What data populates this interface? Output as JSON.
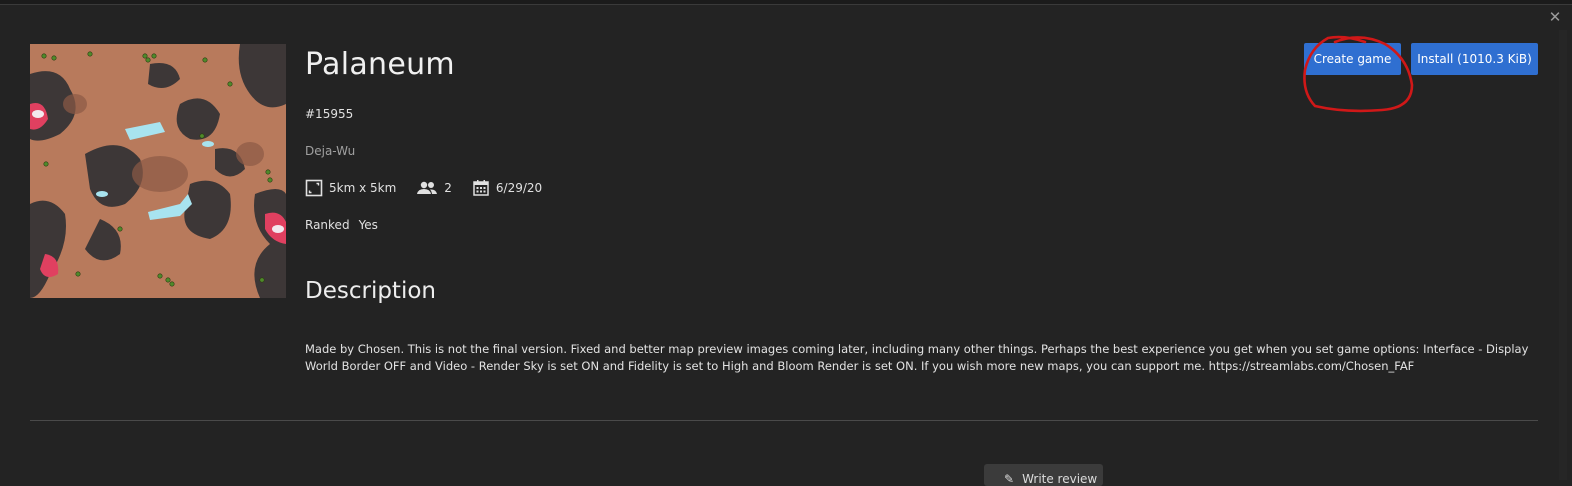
{
  "window": {
    "close_icon": "close-icon"
  },
  "map": {
    "title": "Palaneum",
    "id": "#15955",
    "author": "Deja-Wu",
    "size": "5km x 5km",
    "players": "2",
    "date": "6/29/20",
    "ranked_label": "Ranked",
    "ranked_value": "Yes"
  },
  "actions": {
    "create_game": "Create game",
    "install": "Install (1010.3 KiB)"
  },
  "description": {
    "heading": "Description",
    "text": "Made by Chosen. This is not the final version. Fixed and better map preview images coming later, including many other things. Perhaps the best experience you get when you set game options: Interface - Display World Border OFF and Video - Render Sky is set ON and Fidelity is set to High and Bloom Render is set ON. If you wish more new maps, you can support me. https://streamlabs.com/Chosen_FAF"
  },
  "review": {
    "label": "Write review"
  },
  "icons": [
    "map-size-icon",
    "players-icon",
    "calendar-icon",
    "pencil-icon"
  ],
  "colors": {
    "accent": "#2f6fd1",
    "background": "#232323",
    "annotation": "#d01818"
  }
}
